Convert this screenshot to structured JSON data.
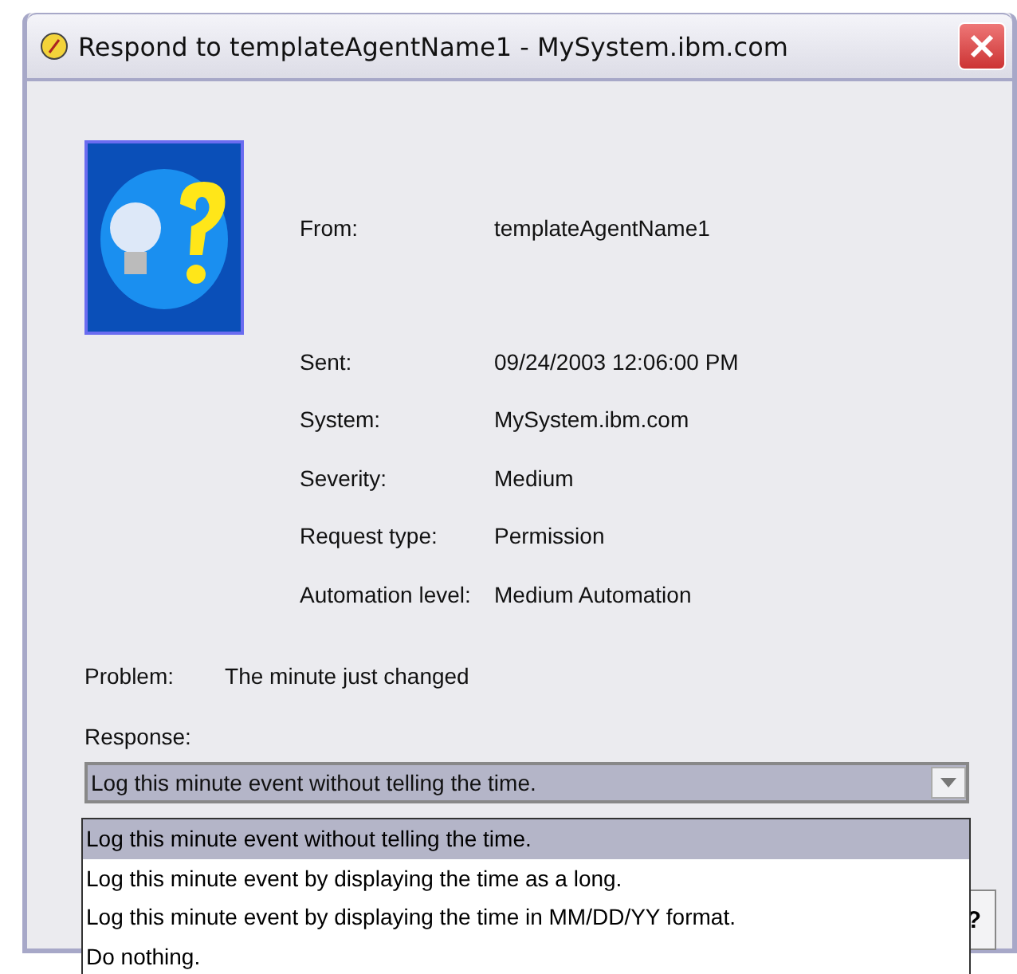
{
  "window": {
    "title": "Respond to templateAgentName1 -  MySystem.ibm.com"
  },
  "fields": [
    {
      "label": "From:",
      "value": "templateAgentName1"
    },
    {
      "label": "Sent:",
      "value": "09/24/2003 12:06:00 PM"
    },
    {
      "label": "System:",
      "value": "MySystem.ibm.com"
    },
    {
      "label": "Severity:",
      "value": "Medium"
    },
    {
      "label": "Request type:",
      "value": "Permission"
    },
    {
      "label": "Automation level:",
      "value": "Medium Automation"
    }
  ],
  "problem": {
    "label": "Problem:",
    "value": "The minute just changed"
  },
  "response": {
    "label": "Response:",
    "value": "Log this minute event without telling the time.",
    "expanded": true,
    "options": [
      {
        "label": "Log this minute event without telling the time.",
        "selected": true
      },
      {
        "label": "Log this minute event by displaying the time as a long.",
        "selected": false
      },
      {
        "label": "Log this minute event by displaying the time in MM/DD/YY format.",
        "selected": false
      },
      {
        "label": "Do nothing.",
        "selected": false
      }
    ]
  },
  "help_button": {
    "label": "?"
  }
}
